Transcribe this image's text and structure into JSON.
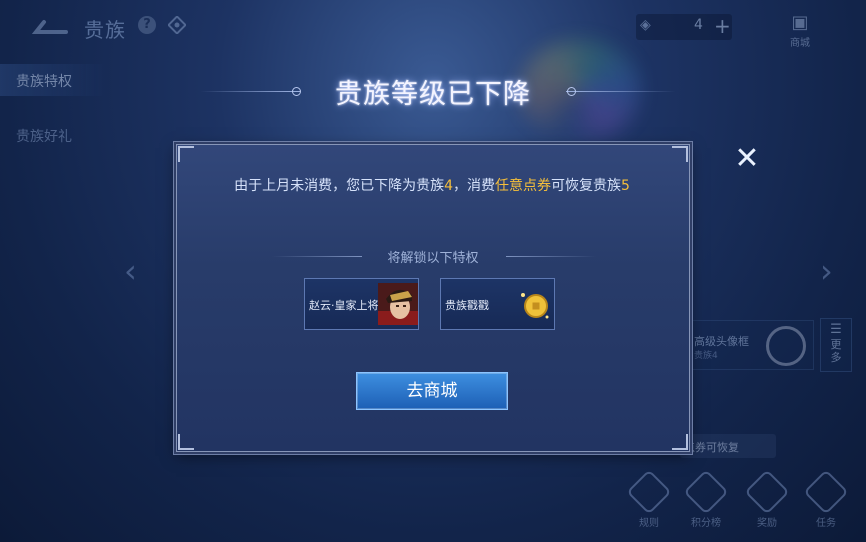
{
  "header": {
    "title": "贵族",
    "coupon_count": "4",
    "coupon_plus": "+",
    "shop_label": "商城"
  },
  "sidebar": {
    "items": [
      {
        "label": "贵族特权"
      },
      {
        "label": "贵族好礼"
      }
    ]
  },
  "background": {
    "avatar_frame_title": "高级头像框",
    "avatar_frame_sub": "贵族4",
    "more_label": "更多",
    "restore_tip": "点券可恢复",
    "bottom_nav": [
      {
        "label": "规则"
      },
      {
        "label": "积分榜"
      },
      {
        "label": "奖励"
      },
      {
        "label": "任务"
      }
    ]
  },
  "dialog": {
    "heading": "贵族等级已下降",
    "message_part1": "由于上月未消费，您已下降为贵族",
    "message_level": "4",
    "message_part2": "，消费",
    "message_highlight": "任意点券",
    "message_part3": "可恢复贵族",
    "message_target_level": "5",
    "unlock_title": "将解锁以下特权",
    "perks": [
      {
        "label": "赵云·皇家上将",
        "icon": "hero-portrait-icon"
      },
      {
        "label": "贵族戳戳",
        "icon": "gold-coin-icon"
      }
    ],
    "button_label": "去商城",
    "close_icon": "close-icon"
  },
  "colors": {
    "highlight": "#f5bf3b",
    "button": "#2a73cc",
    "background": "#1d3363"
  }
}
